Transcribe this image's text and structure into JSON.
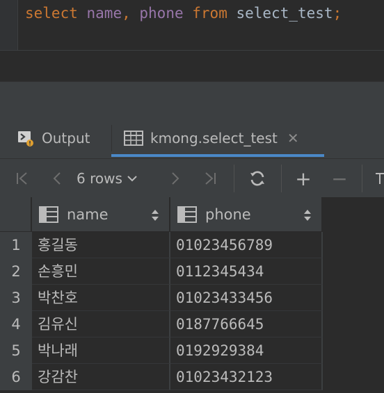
{
  "editor": {
    "sql": [
      {
        "text": "select",
        "kind": "kw"
      },
      {
        "text": " ",
        "kind": "tx"
      },
      {
        "text": "name",
        "kind": "id"
      },
      {
        "text": ", ",
        "kind": "kw"
      },
      {
        "text": "phone",
        "kind": "id"
      },
      {
        "text": " ",
        "kind": "tx"
      },
      {
        "text": "from",
        "kind": "kw"
      },
      {
        "text": " select_test",
        "kind": "tx"
      },
      {
        "text": ";",
        "kind": "kw"
      }
    ]
  },
  "tabs": {
    "output_label": "Output",
    "table_label": "kmong.select_test",
    "close_glyph": "✕"
  },
  "toolbar": {
    "first": "|<",
    "prev": "<",
    "rows_label": "6 rows",
    "rows_chevron": "⌄",
    "next": ">",
    "last": ">|",
    "add": "+",
    "remove": "−"
  },
  "table": {
    "columns": [
      {
        "name": "name"
      },
      {
        "name": "phone"
      }
    ],
    "rows": [
      {
        "num": "1",
        "name": "홍길동",
        "phone": "01023456789"
      },
      {
        "num": "2",
        "name": "손흥민",
        "phone": "0112345434"
      },
      {
        "num": "3",
        "name": "박찬호",
        "phone": "01023433456"
      },
      {
        "num": "4",
        "name": "김유신",
        "phone": "0187766645"
      },
      {
        "num": "5",
        "name": "박나래",
        "phone": "0192929384"
      },
      {
        "num": "6",
        "name": "강감찬",
        "phone": "01023432123"
      }
    ]
  },
  "colors": {
    "keyword": "#cc7832",
    "identifier": "#9876aa",
    "text": "#a9b7c6",
    "panel": "#3c3f41",
    "background": "#2b2b2b",
    "accent": "#4a88c7"
  }
}
